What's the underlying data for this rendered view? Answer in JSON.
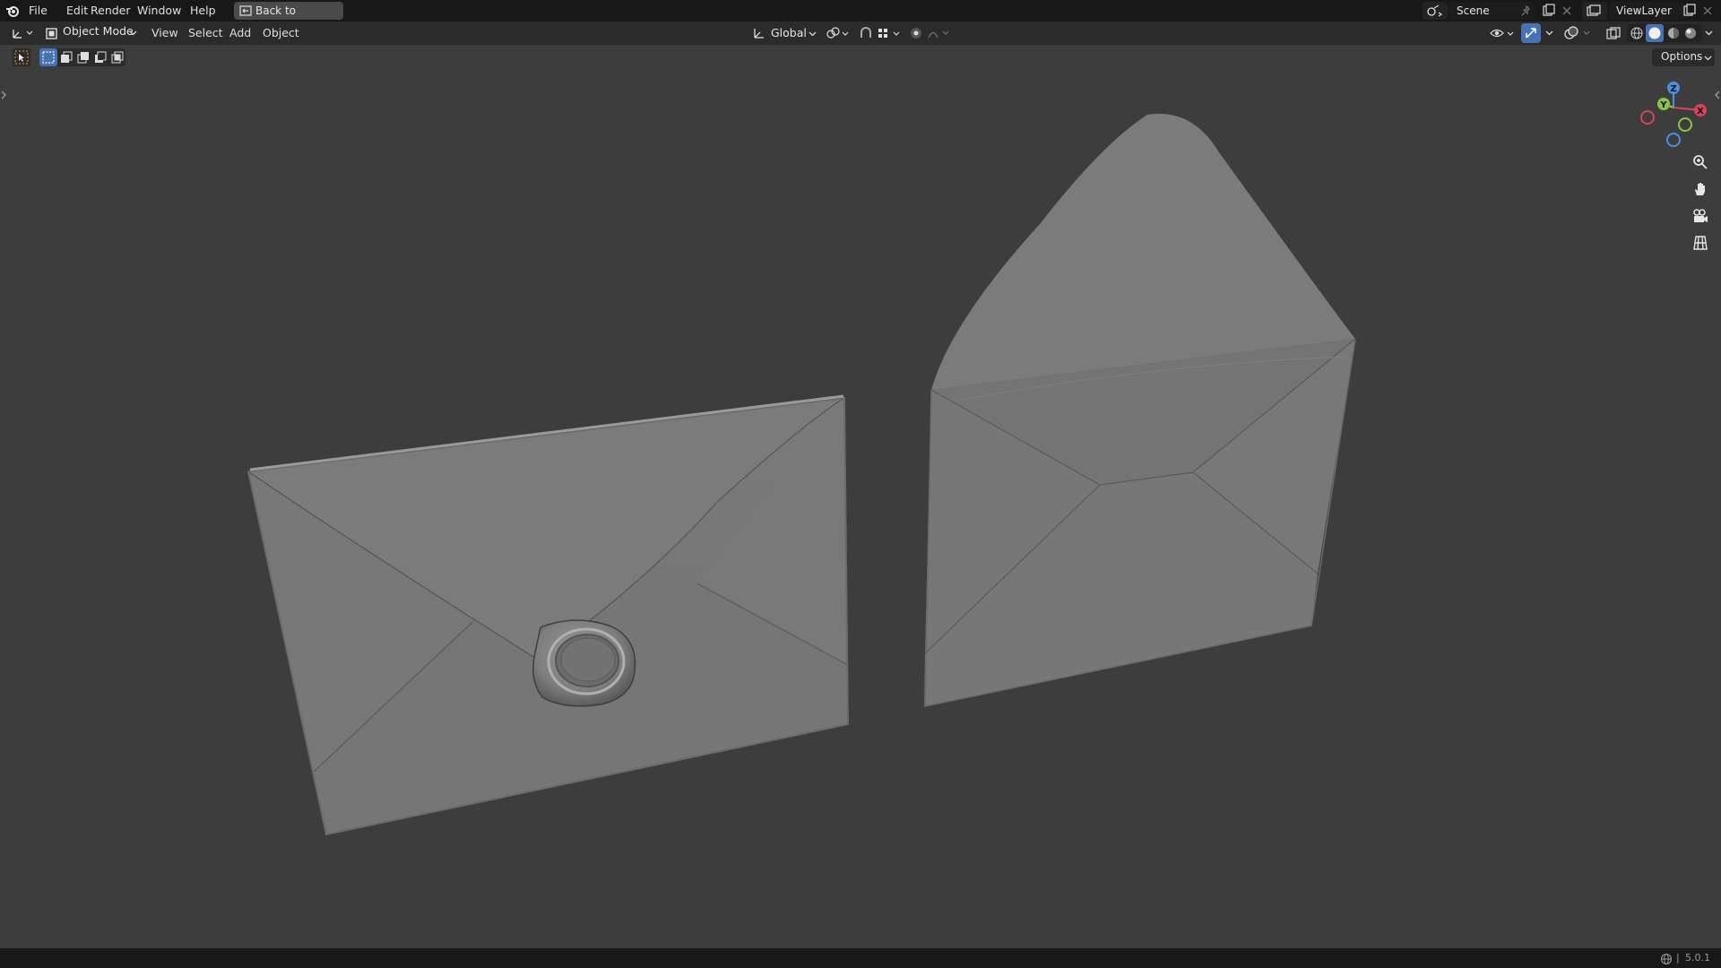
{
  "topbar": {
    "menus": [
      "File",
      "Edit",
      "Render",
      "Window",
      "Help"
    ],
    "back_button": "Back to Previous",
    "scene_name": "Scene",
    "view_layer": "ViewLayer"
  },
  "viewport_header": {
    "mode": "Object Mode",
    "menus": [
      "View",
      "Select",
      "Add",
      "Object"
    ],
    "transform_orientation": "Global",
    "options_label": "Options"
  },
  "gizmo": {
    "axes": [
      "Z",
      "Y",
      "X"
    ],
    "colors": {
      "x": "#d9435c",
      "y": "#8bc34a",
      "z": "#4a90e2"
    }
  },
  "status": {
    "version": "5.0.1"
  },
  "colors": {
    "background": "#3d3d3d",
    "header": "#2b2b2b",
    "topbar": "#181818",
    "accent": "#4772b3"
  },
  "icons": [
    "blender-logo-icon",
    "editor-type-icon",
    "object-mode-icon",
    "select-box-icon",
    "transform-orientation-icon",
    "pivot-icon",
    "snap-icon",
    "proportional-edit-icon",
    "view-object-types-icon",
    "gizmo-icon",
    "overlay-icon",
    "xray-icon",
    "shading-wireframe-icon",
    "shading-solid-icon",
    "shading-material-icon",
    "shading-rendered-icon",
    "zoom-icon",
    "pan-hand-icon",
    "camera-icon",
    "grid-ortho-icon"
  ]
}
